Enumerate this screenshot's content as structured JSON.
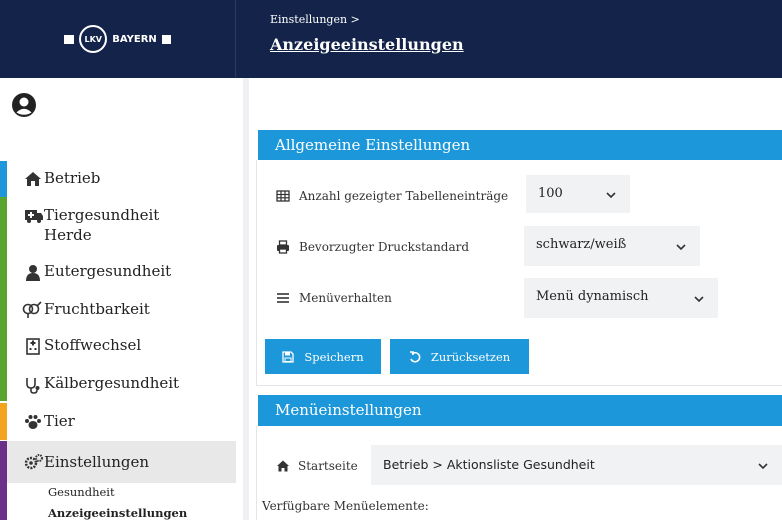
{
  "header": {
    "logo_text_left": "LKV",
    "logo_text_right": "BAYERN",
    "breadcrumb": "Einstellungen >",
    "title": "Anzeigeeinstellungen"
  },
  "sidebar": {
    "items": [
      {
        "label": "Betrieb",
        "color": "#1c97d9",
        "icon": "house-icon"
      },
      {
        "label": "Tiergesundheit\nHerde",
        "color": "#5aa52f",
        "icon": "ambulance-icon"
      },
      {
        "label": "Eutergesundheit",
        "color": "#5aa52f",
        "icon": "udder-icon"
      },
      {
        "label": "Fruchtbarkeit",
        "color": "#5aa52f",
        "icon": "gender-icon"
      },
      {
        "label": "Stoffwechsel",
        "color": "#5aa52f",
        "icon": "hospital-icon"
      },
      {
        "label": "Kälbergesundheit",
        "color": "#5aa52f",
        "icon": "stethoscope-icon"
      },
      {
        "label": "Tier",
        "color": "#f2a41d",
        "icon": "paw-icon"
      },
      {
        "label": "Einstellungen",
        "color": "#6b2f8a",
        "icon": "gears-icon"
      }
    ],
    "sub_items": [
      "Gesundheit",
      "Anzeigeeinstellungen"
    ]
  },
  "general_settings": {
    "title": "Allgemeine Einstellungen",
    "rows": [
      {
        "label": "Anzahl gezeigter Tabelleneinträge",
        "value": "100",
        "icon": "table-icon"
      },
      {
        "label": "Bevorzugter Druckstandard",
        "value": "schwarz/weiß",
        "icon": "printer-icon"
      },
      {
        "label": "Menüverhalten",
        "value": "Menü dynamisch",
        "icon": "menu-icon"
      }
    ],
    "save_label": "Speichern",
    "reset_label": "Zurücksetzen"
  },
  "menu_settings": {
    "title": "Menüeinstellungen",
    "start_label": "Startseite",
    "start_value": "Betrieb > Aktionsliste Gesundheit",
    "available_label": "Verfügbare Menüelemente:"
  },
  "colors": {
    "header_bg": "#14234a",
    "accent": "#1c97d9"
  }
}
